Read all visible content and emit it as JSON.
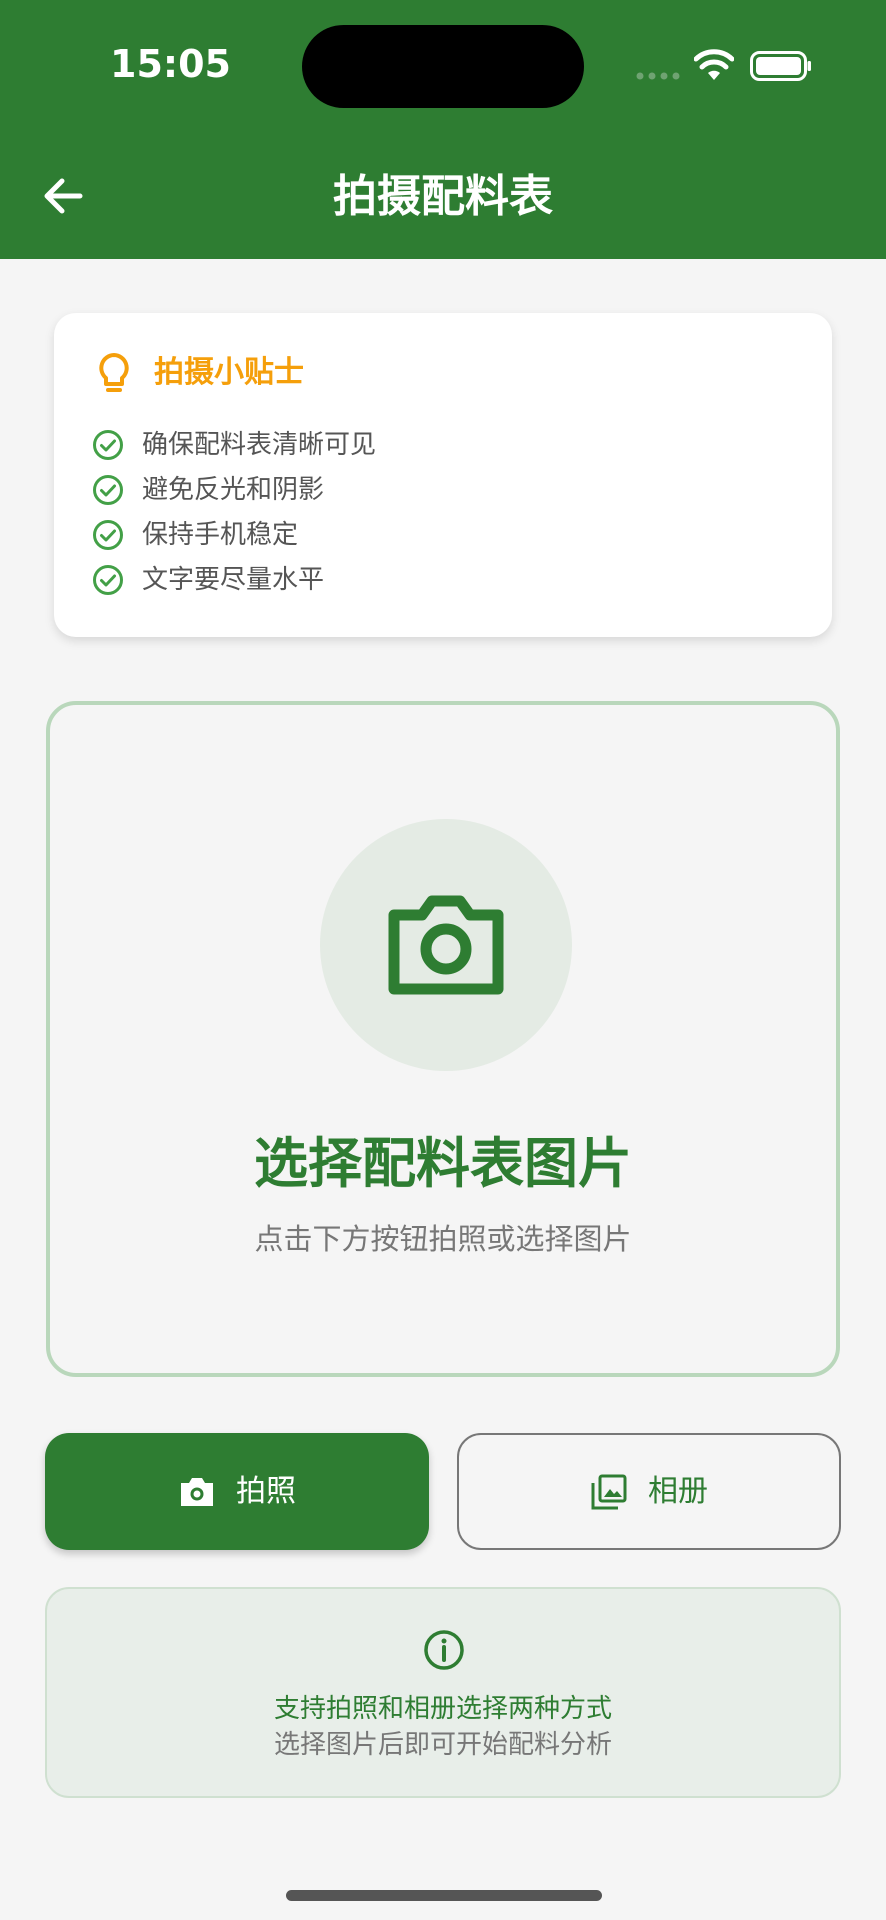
{
  "status_bar": {
    "time": "15:05"
  },
  "header": {
    "title": "拍摄配料表",
    "back_icon": "arrow-left-icon",
    "background": "#2e7d32"
  },
  "tips": {
    "title": "拍摄小贴士",
    "title_color": "#f59f0b",
    "items": [
      "确保配料表清晰可见",
      "避免反光和阴影",
      "保持手机稳定",
      "文字要尽量水平"
    ]
  },
  "upload": {
    "icon": "camera-icon",
    "title": "选择配料表图片",
    "subtitle": "点击下方按钮拍照或选择图片"
  },
  "actions": {
    "camera_label": "拍照",
    "album_label": "相册"
  },
  "info": {
    "icon": "info-icon",
    "line1": "支持拍照和相册选择两种方式",
    "line2": "选择图片后即可开始配料分析"
  },
  "colors": {
    "primary": "#2e7d32",
    "accent": "#f59f0b",
    "background": "#f5f5f5"
  }
}
